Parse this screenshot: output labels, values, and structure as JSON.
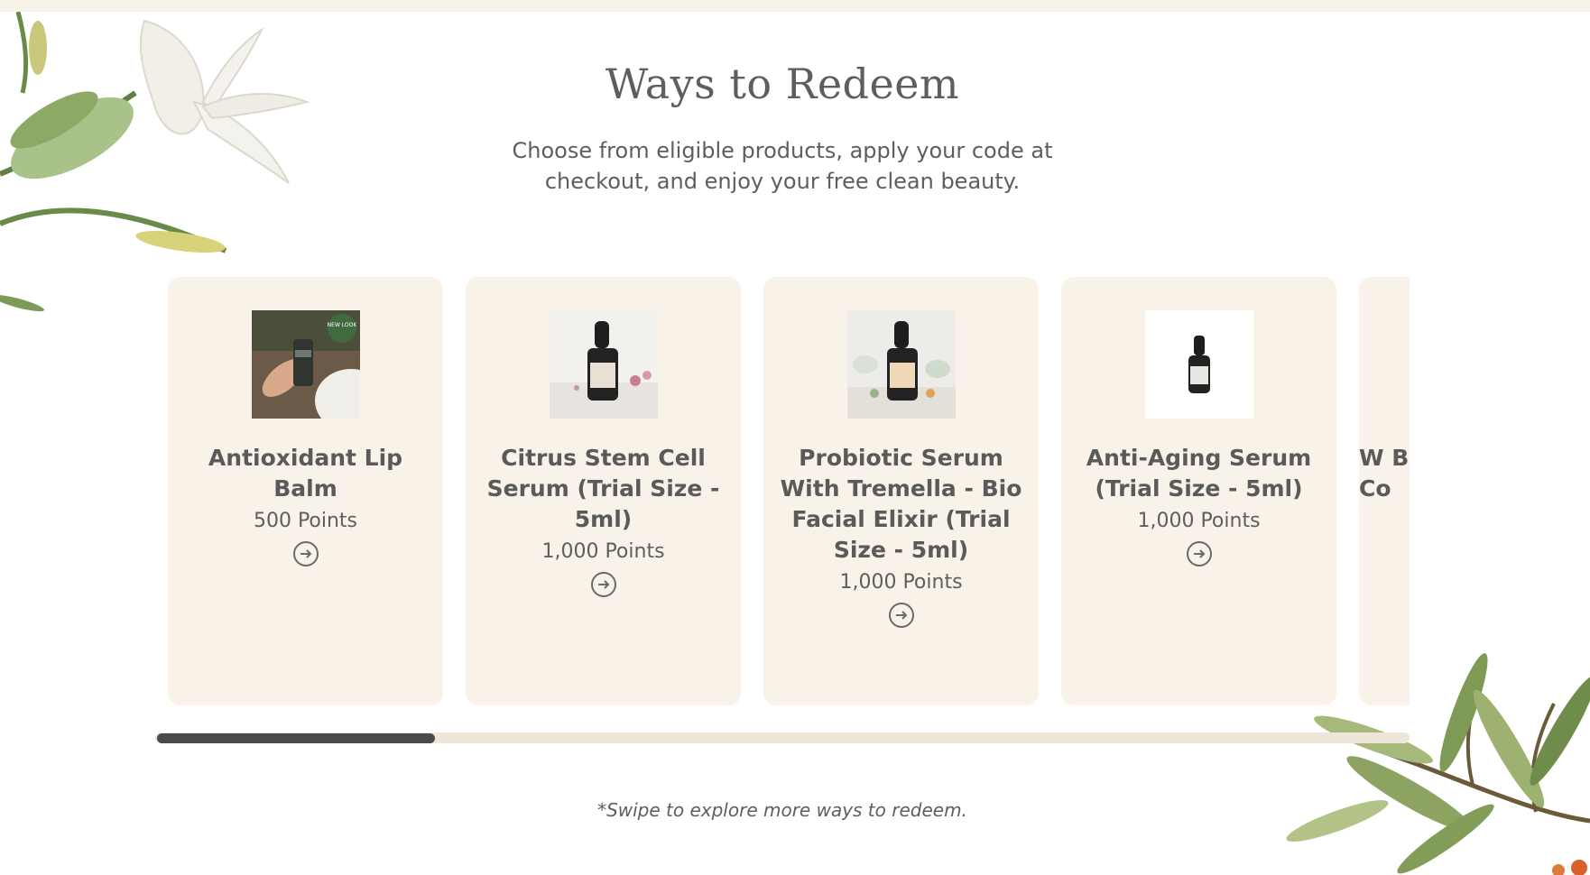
{
  "section": {
    "title": "Ways to Redeem",
    "subtitle": "Choose from eligible products, apply your code at checkout, and enjoy your free clean beauty.",
    "swipe_note": "*Swipe to explore more ways to redeem."
  },
  "colors": {
    "card_bg": "#f8f2e8",
    "text": "#5a5a5a",
    "scroll_track": "#efe6da",
    "scroll_thumb": "#4a4a4a"
  },
  "carousel": {
    "scroll_position_fraction": 0.22,
    "cards": [
      {
        "title": "Antioxidant Lip Balm",
        "points": "500 Points",
        "image": "lip-balm-in-hand-photo",
        "badge": "NEW LOOK",
        "action_icon": "arrow-circle-right-icon"
      },
      {
        "title": "Citrus Stem Cell Serum (Trial Size - 5ml)",
        "points": "1,000 Points",
        "image": "dropper-bottle-with-flowers-photo",
        "action_icon": "arrow-circle-right-icon"
      },
      {
        "title": "Probiotic Serum With Tremella - Bio Facial Elixir (Trial Size - 5ml)",
        "points": "1,000 Points",
        "image": "dropper-bottle-with-herbs-photo",
        "action_icon": "arrow-circle-right-icon"
      },
      {
        "title": "Anti-Aging Serum (Trial Size - 5ml)",
        "points": "1,000 Points",
        "image": "dropper-bottle-white-background-photo",
        "action_icon": "arrow-circle-right-icon"
      },
      {
        "title": "W B Co",
        "points": "",
        "image": "",
        "action_icon": "arrow-circle-right-icon"
      }
    ]
  }
}
